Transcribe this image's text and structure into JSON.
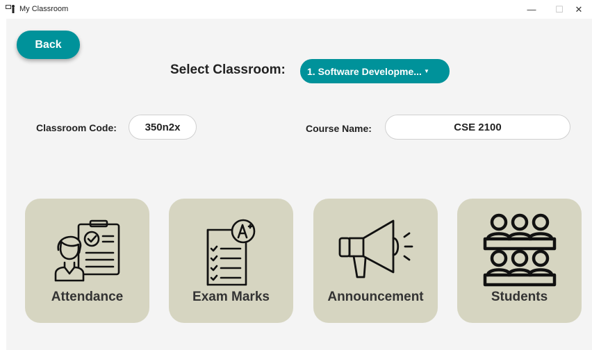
{
  "window": {
    "title": "My Classroom",
    "min_glyph": "—",
    "max_glyph": "☐",
    "close_glyph": "✕"
  },
  "header": {
    "back_label": "Back",
    "select_label": "Select Classroom:",
    "selected_classroom": "1. Software Developme...",
    "dropdown_arrow": "▼"
  },
  "fields": {
    "code_label": "Classroom Code:",
    "code_value": "350n2x",
    "course_label": "Course Name:",
    "course_value": "CSE 2100"
  },
  "cards": [
    {
      "label": "Attendance",
      "icon": "attendance-icon"
    },
    {
      "label": "Exam Marks",
      "icon": "exam-marks-icon"
    },
    {
      "label": "Announcement",
      "icon": "megaphone-icon"
    },
    {
      "label": "Students",
      "icon": "students-icon"
    }
  ],
  "colors": {
    "accent": "#00929a",
    "card_bg": "#d6d5c1",
    "client_bg": "#f4f4f4"
  }
}
